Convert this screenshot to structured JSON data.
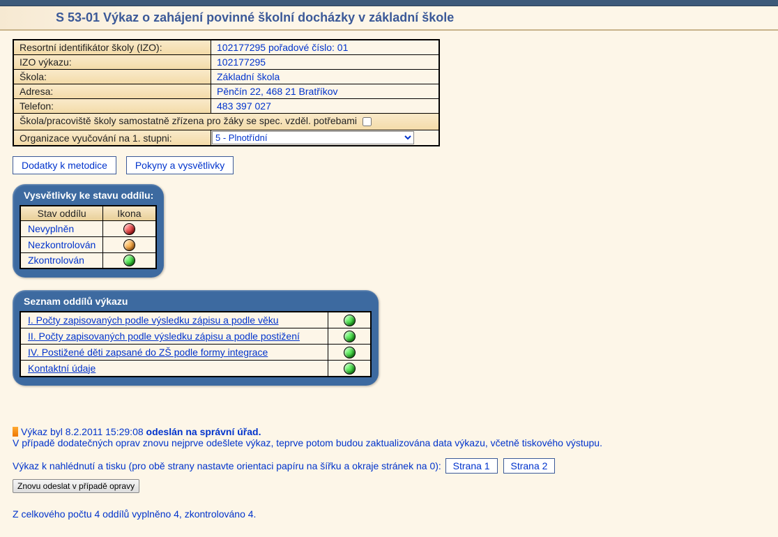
{
  "page_title": "S 53-01 Výkaz o zahájení povinné školní docházky v základní škole",
  "info": {
    "izo_label": "Resortní identifikátor školy (IZO):",
    "izo_value": "102177295 pořadové číslo: 01",
    "izo2_label": "IZO výkazu:",
    "izo2_value": "102177295",
    "school_label": "Škola:",
    "school_value": "Základní škola",
    "address_label": "Adresa:",
    "address_value": "Pěnčín 22, 468 21 Bratříkov",
    "phone_label": "Telefon:",
    "phone_value": "483 397 027",
    "spec_label": "Škola/pracoviště školy samostatně zřízena pro žáky se spec. vzděl. potřebami",
    "org_label": "Organizace vyučování na 1. stupni:",
    "org_value": "5 - Plnotřídní"
  },
  "buttons": {
    "dodatky": "Dodatky k metodice",
    "pokyny": "Pokyny a vysvětlivky",
    "strana1": "Strana 1",
    "strana2": "Strana 2",
    "resend": "Znovu odeslat v případě opravy"
  },
  "legend": {
    "title": "Vysvětlivky ke stavu oddílu:",
    "col_state": "Stav oddílu",
    "col_icon": "Ikona",
    "rows": [
      {
        "label": "Nevyplněn",
        "color": "red"
      },
      {
        "label": "Nezkontrolován",
        "color": "orange"
      },
      {
        "label": "Zkontrolován",
        "color": "green"
      }
    ]
  },
  "sections": {
    "title": "Seznam oddílů výkazu",
    "rows": [
      {
        "label": "I. Počty zapisovaných podle výsledku zápisu a podle věku",
        "color": "green"
      },
      {
        "label": "II. Počty zapisovaných podle výsledku zápisu a podle postižení",
        "color": "green"
      },
      {
        "label": "IV. Postižené děti zapsané do ZŠ podle formy integrace",
        "color": "green"
      },
      {
        "label": "Kontaktní údaje",
        "color": "green"
      }
    ]
  },
  "status": {
    "line1_prefix": "Výkaz byl 8.2.2011 15:29:08 ",
    "line1_bold": "odeslán na správní úřad.",
    "line2": "V případě dodatečných oprav znovu nejprve odešlete výkaz, teprve potom budou zaktualizována data výkazu, včetně tiskového výstupu."
  },
  "preview_label": "Výkaz k nahlédnutí a tisku (pro obě strany nastavte orientaci papíru na šířku a okraje stránek na 0): ",
  "summary": "Z celkového počtu 4 oddílů vyplněno 4, zkontrolováno 4."
}
